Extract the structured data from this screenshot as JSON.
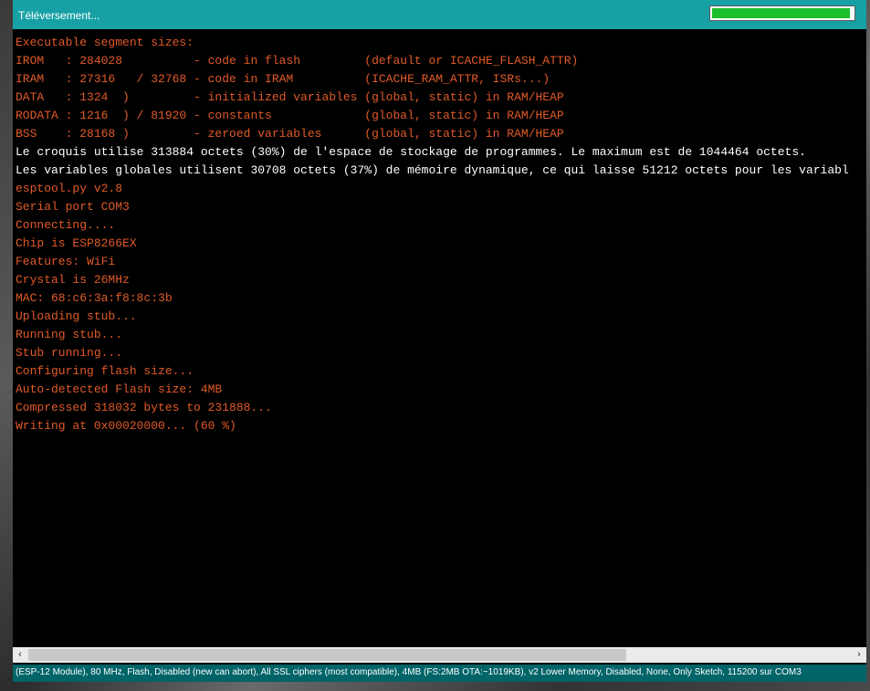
{
  "header": {
    "status": "Téléversement...",
    "progress": 0.98
  },
  "console": {
    "lines": [
      {
        "text": "Executable segment sizes:",
        "kind": "err"
      },
      {
        "text": "IROM   : 284028          - code in flash         (default or ICACHE_FLASH_ATTR)",
        "kind": "err"
      },
      {
        "text": "IRAM   : 27316   / 32768 - code in IRAM          (ICACHE_RAM_ATTR, ISRs...)",
        "kind": "err"
      },
      {
        "text": "DATA   : 1324  )         - initialized variables (global, static) in RAM/HEAP",
        "kind": "err"
      },
      {
        "text": "RODATA : 1216  ) / 81920 - constants             (global, static) in RAM/HEAP",
        "kind": "err"
      },
      {
        "text": "BSS    : 28168 )         - zeroed variables      (global, static) in RAM/HEAP",
        "kind": "err"
      },
      {
        "text": "Le croquis utilise 313884 octets (30%) de l'espace de stockage de programmes. Le maximum est de 1044464 octets.",
        "kind": "out"
      },
      {
        "text": "Les variables globales utilisent 30708 octets (37%) de mémoire dynamique, ce qui laisse 51212 octets pour les variabl",
        "kind": "out"
      },
      {
        "text": "esptool.py v2.8",
        "kind": "err"
      },
      {
        "text": "Serial port COM3",
        "kind": "err"
      },
      {
        "text": "Connecting....",
        "kind": "err"
      },
      {
        "text": "Chip is ESP8266EX",
        "kind": "err"
      },
      {
        "text": "Features: WiFi",
        "kind": "err"
      },
      {
        "text": "Crystal is 26MHz",
        "kind": "err"
      },
      {
        "text": "MAC: 68:c6:3a:f8:8c:3b",
        "kind": "err"
      },
      {
        "text": "Uploading stub...",
        "kind": "err"
      },
      {
        "text": "Running stub...",
        "kind": "err"
      },
      {
        "text": "Stub running...",
        "kind": "err"
      },
      {
        "text": "Configuring flash size...",
        "kind": "err"
      },
      {
        "text": "Auto-detected Flash size: 4MB",
        "kind": "err"
      },
      {
        "text": "Compressed 318032 bytes to 231888...",
        "kind": "err"
      },
      {
        "text": "Writing at 0x00020000... (60 %)",
        "kind": "err"
      }
    ]
  },
  "scrollbar": {
    "left_icon": "chevron-left-icon",
    "right_icon": "chevron-right-icon"
  },
  "board_status": "(ESP-12 Module), 80 MHz, Flash, Disabled (new can abort), All SSL ciphers (most compatible), 4MB (FS:2MB OTA:~1019KB), v2 Lower Memory, Disabled, None, Only Sketch, 115200 sur COM3",
  "colors": {
    "header_bg": "#17a1a5",
    "progress_fill": "#1bbf2c",
    "console_error_text": "#e15a28",
    "console_output_text": "#ffffff",
    "board_status_bg": "#006468"
  }
}
